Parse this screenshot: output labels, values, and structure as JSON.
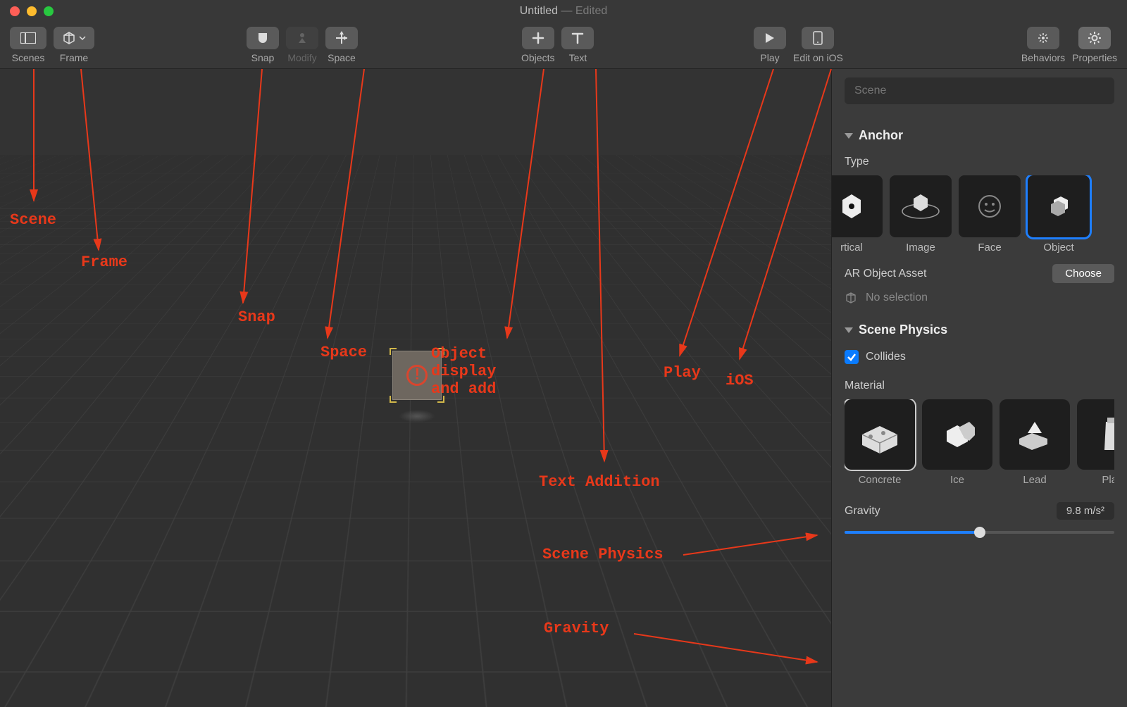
{
  "window": {
    "title": "Untitled",
    "subtitle": " — Edited"
  },
  "toolbar": {
    "scenes": "Scenes",
    "frame": "Frame",
    "snap": "Snap",
    "modify": "Modify",
    "space": "Space",
    "objects": "Objects",
    "text": "Text",
    "play": "Play",
    "edit_ios": "Edit on iOS",
    "behaviors": "Behaviors",
    "properties": "Properties"
  },
  "inspector": {
    "search_placeholder": "Scene",
    "anchor_section": "Anchor",
    "type_label": "Type",
    "anchors": [
      {
        "id": "vertical",
        "label": "rtical"
      },
      {
        "id": "image",
        "label": "Image"
      },
      {
        "id": "face",
        "label": "Face"
      },
      {
        "id": "object",
        "label": "Object",
        "selected": true
      }
    ],
    "ar_object_asset_label": "AR Object Asset",
    "choose_label": "Choose",
    "no_selection": "No selection",
    "physics_section": "Scene Physics",
    "collides": "Collides",
    "material_label": "Material",
    "materials": [
      {
        "id": "concrete",
        "label": "Concrete",
        "selected": true
      },
      {
        "id": "ice",
        "label": "Ice"
      },
      {
        "id": "lead",
        "label": "Lead"
      },
      {
        "id": "plastic",
        "label": "Plas"
      }
    ],
    "gravity_label": "Gravity",
    "gravity_value": "9.8 m/s²"
  },
  "annotations": {
    "scene": "Scene",
    "frame": "Frame",
    "snap": "Snap",
    "space": "Space",
    "object_add": "Object \ndisplay \nand add",
    "play": "Play",
    "ios": "iOS",
    "text_addition": "Text Addition",
    "scene_physics": "Scene Physics",
    "gravity": "Gravity"
  }
}
